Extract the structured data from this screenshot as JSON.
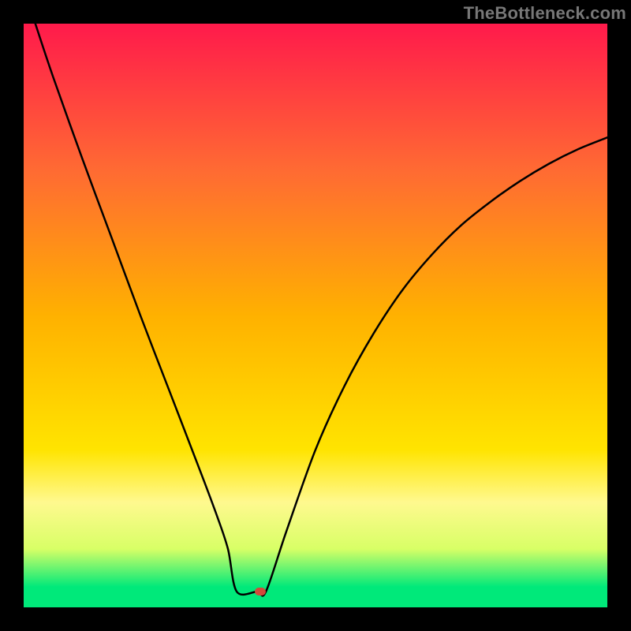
{
  "watermark": {
    "text": "TheBottleneck.com"
  },
  "marker": {
    "color": "#d24a3a"
  },
  "chart_data": {
    "type": "line",
    "title": "",
    "xlabel": "",
    "ylabel": "",
    "xlim": [
      0,
      100
    ],
    "ylim": [
      0,
      100
    ],
    "grid": false,
    "legend": false,
    "background_gradient": {
      "orientation": "vertical",
      "stops": [
        {
          "pos": 0.0,
          "color": "#ff1a4b"
        },
        {
          "pos": 0.25,
          "color": "#ff6a33"
        },
        {
          "pos": 0.5,
          "color": "#ffb100"
        },
        {
          "pos": 0.73,
          "color": "#ffe400"
        },
        {
          "pos": 0.82,
          "color": "#fff98f"
        },
        {
          "pos": 0.9,
          "color": "#d8ff66"
        },
        {
          "pos": 0.965,
          "color": "#00e97a"
        },
        {
          "pos": 1.0,
          "color": "#00e97a"
        }
      ]
    },
    "series": [
      {
        "name": "bottleneck-curve",
        "color": "#000000",
        "x": [
          2.0,
          5,
          10,
          15,
          20,
          25,
          30,
          33,
          35,
          36.5,
          40,
          41.5,
          45,
          50,
          55,
          60,
          65,
          70,
          75,
          80,
          85,
          90,
          95,
          100
        ],
        "y": [
          100,
          91,
          77,
          63.5,
          50,
          37,
          24,
          16,
          10,
          2.7,
          2.7,
          2.7,
          13,
          27,
          38,
          47,
          54.5,
          60.5,
          65.5,
          69.5,
          73,
          76,
          78.5,
          80.5
        ]
      }
    ],
    "marker_point": {
      "x": 40.5,
      "y": 2.7
    }
  }
}
